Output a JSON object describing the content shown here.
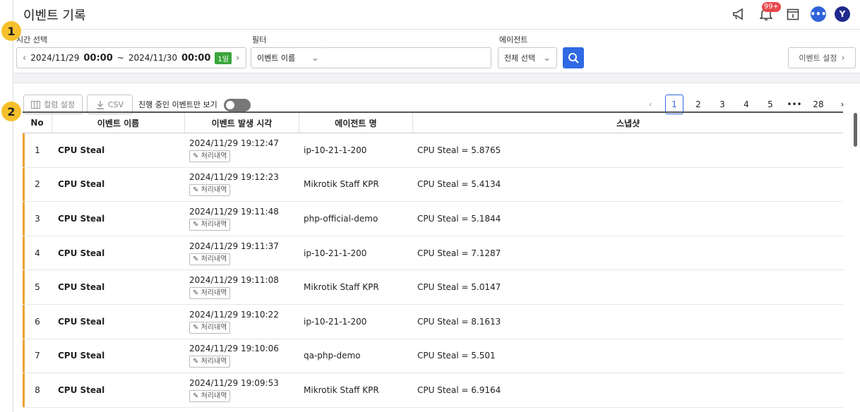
{
  "markers": [
    "1",
    "2"
  ],
  "header": {
    "title": "이벤트 기록",
    "notification_count": "99+",
    "avatar_letter": "Y"
  },
  "filters": {
    "time_label": "시간 선택",
    "time_start_date": "2024/11/29",
    "time_start_time": "00:00",
    "time_sep": "~",
    "time_end_date": "2024/11/30",
    "time_end_time": "00:00",
    "time_range_tag": "1일",
    "filter_label": "필터",
    "filter_select": "이벤트 이름",
    "filter_text": "",
    "agent_label": "에이전트",
    "agent_select": "전체 선택",
    "event_settings": "이벤트 설정"
  },
  "toolbar": {
    "column_settings": "컬럼 설정",
    "csv": "CSV",
    "ongoing_label": "진행 중인 이벤트만 보기",
    "ongoing_on": false
  },
  "pagination": {
    "pages": [
      "1",
      "2",
      "3",
      "4",
      "5"
    ],
    "ellipsis": "•••",
    "last": "28",
    "active": "1"
  },
  "table": {
    "columns": [
      "No",
      "이벤트 이름",
      "이벤트 발생 시각",
      "에이전트 명",
      "스냅샷"
    ],
    "history_label": "처리내역",
    "rows": [
      {
        "no": "1",
        "name": "CPU Steal",
        "time": "2024/11/29 19:12:47",
        "agent": "ip-10-21-1-200",
        "snapshot": "CPU Steal = 5.8765"
      },
      {
        "no": "2",
        "name": "CPU Steal",
        "time": "2024/11/29 19:12:23",
        "agent": "Mikrotik Staff KPR",
        "snapshot": "CPU Steal = 5.4134"
      },
      {
        "no": "3",
        "name": "CPU Steal",
        "time": "2024/11/29 19:11:48",
        "agent": "php-official-demo",
        "snapshot": "CPU Steal = 5.1844"
      },
      {
        "no": "4",
        "name": "CPU Steal",
        "time": "2024/11/29 19:11:37",
        "agent": "ip-10-21-1-200",
        "snapshot": "CPU Steal = 7.1287"
      },
      {
        "no": "5",
        "name": "CPU Steal",
        "time": "2024/11/29 19:11:08",
        "agent": "Mikrotik Staff KPR",
        "snapshot": "CPU Steal = 5.0147"
      },
      {
        "no": "6",
        "name": "CPU Steal",
        "time": "2024/11/29 19:10:22",
        "agent": "ip-10-21-1-200",
        "snapshot": "CPU Steal = 8.1613"
      },
      {
        "no": "7",
        "name": "CPU Steal",
        "time": "2024/11/29 19:10:06",
        "agent": "qa-php-demo",
        "snapshot": "CPU Steal = 5.501"
      },
      {
        "no": "8",
        "name": "CPU Steal",
        "time": "2024/11/29 19:09:53",
        "agent": "Mikrotik Staff KPR",
        "snapshot": "CPU Steal = 6.9164"
      }
    ]
  },
  "colors": {
    "accent": "#2f6ae4",
    "row_marker": "#f0a12f",
    "tag_green": "#3aa53a",
    "badge": "#e8474c",
    "callout": "#f5c02b"
  }
}
